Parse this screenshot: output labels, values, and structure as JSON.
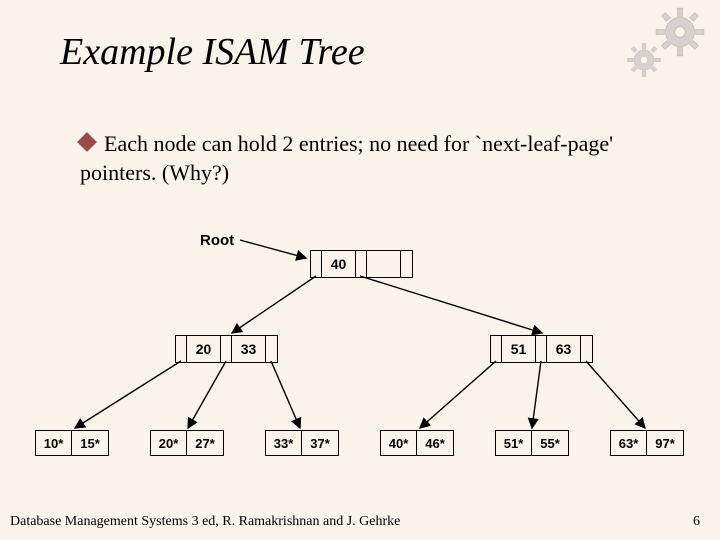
{
  "title": "Example ISAM Tree",
  "bullet_text": "Each node can hold 2 entries; no need for `next-leaf-page' pointers.  (Why?)",
  "root_label": "Root",
  "tree": {
    "root": {
      "cells": [
        "40",
        ""
      ]
    },
    "index_left": {
      "cells": [
        "20",
        "33"
      ]
    },
    "index_right": {
      "cells": [
        "51",
        "63"
      ]
    },
    "leaves": [
      {
        "cells": [
          "10*",
          "15*"
        ]
      },
      {
        "cells": [
          "20*",
          "27*"
        ]
      },
      {
        "cells": [
          "33*",
          "37*"
        ]
      },
      {
        "cells": [
          "40*",
          "46*"
        ]
      },
      {
        "cells": [
          "51*",
          "55*"
        ]
      },
      {
        "cells": [
          "63*",
          "97*"
        ]
      }
    ]
  },
  "footer_left": "Database Management Systems 3 ed,  R. Ramakrishnan and J. Gehrke",
  "footer_right": "6"
}
